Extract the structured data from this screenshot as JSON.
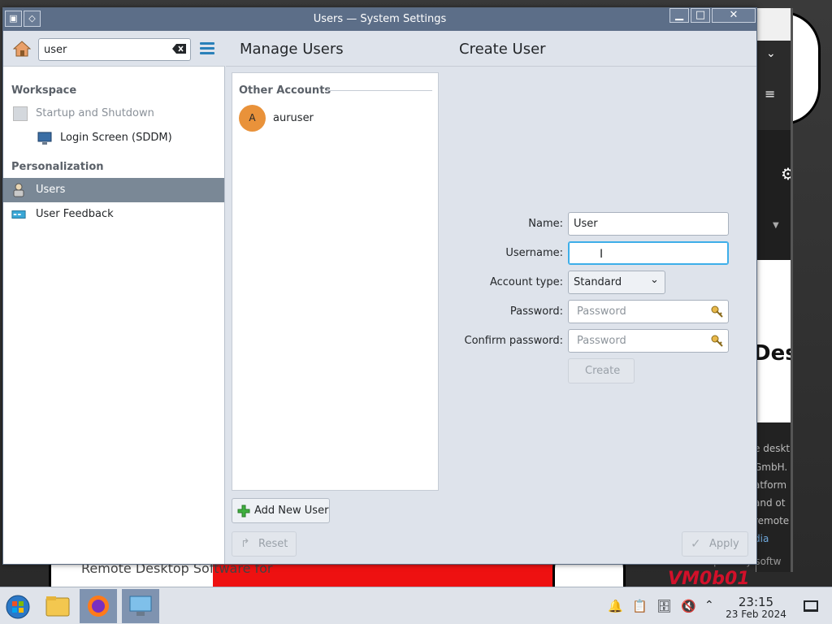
{
  "window": {
    "title": "Users — System Settings",
    "controls": {
      "minimize": "▁",
      "maximize": "□",
      "close": "✕"
    }
  },
  "sidebar": {
    "search_value": "user",
    "categories": [
      {
        "label": "Workspace",
        "items": [
          {
            "label": "Startup and Shutdown",
            "icon": "startup-icon",
            "indent": false,
            "disabled": true
          },
          {
            "label": "Login Screen (SDDM)",
            "icon": "login-screen-icon",
            "indent": true,
            "disabled": false
          }
        ]
      },
      {
        "label": "Personalization",
        "items": [
          {
            "label": "Users",
            "icon": "users-icon",
            "selected": true
          },
          {
            "label": "User Feedback",
            "icon": "feedback-icon",
            "selected": false
          }
        ]
      }
    ]
  },
  "main": {
    "manage_title": "Manage Users",
    "create_title": "Create User",
    "accounts": {
      "section_label": "Other Accounts",
      "list": [
        {
          "initial": "A",
          "name": "auruser"
        }
      ]
    },
    "add_user_label": "Add New User",
    "reset_label": "Reset",
    "apply_label": "Apply"
  },
  "form": {
    "name_label": "Name:",
    "name_value": "User",
    "username_label": "Username:",
    "username_value": "",
    "account_type_label": "Account type:",
    "account_type_value": "Standard",
    "password_label": "Password:",
    "password_placeholder": "Password",
    "confirm_label": "Confirm password:",
    "confirm_placeholder": "Password",
    "create_label": "Create"
  },
  "background": {
    "fragments": [
      "Des",
      "e deskt",
      "GmbH.",
      "atform",
      "and ot",
      "remote",
      "dia",
      "License: Proprietary softw",
      "Remote Desktop Software for",
      "VM0b01"
    ]
  },
  "taskbar": {
    "time": "23:15",
    "date": "23 Feb 2024",
    "apps": [
      "start-menu",
      "file-manager",
      "firefox",
      "system-settings"
    ]
  },
  "colors": {
    "accent": "#3daee9",
    "titlebar": "#5c6e88",
    "selection": "#7a8896",
    "link": "#2980b9"
  }
}
